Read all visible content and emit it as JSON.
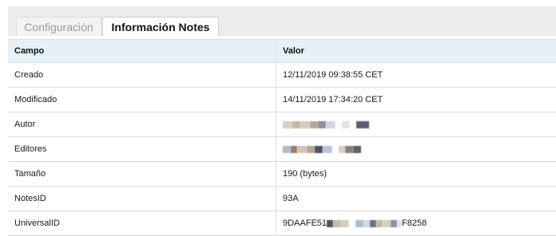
{
  "tabs": [
    {
      "label": "Configuración",
      "active": false
    },
    {
      "label": "Información Notes",
      "active": true
    }
  ],
  "table": {
    "headers": {
      "field": "Campo",
      "value": "Valor"
    },
    "rows": [
      {
        "field": "Creado",
        "value": "12/11/2019 09:38:55 CET"
      },
      {
        "field": "Modificado",
        "value": "14/11/2019 17:34:20 CET"
      },
      {
        "field": "Autor",
        "value": "",
        "redacted": true
      },
      {
        "field": "Editores",
        "value": "",
        "redacted": true
      },
      {
        "field": "Tamaño",
        "value": "190 (bytes)"
      },
      {
        "field": "NotesID",
        "value": "93A"
      },
      {
        "field": "UniversalID",
        "value_prefix": "9DAAFE51",
        "value_suffix": "F8258",
        "partially_redacted": true
      }
    ]
  },
  "colors": {
    "header_background": "#e4f1f9",
    "tabbar_background": "#ececec",
    "row_border": "#d7dde3",
    "redaction_palette": [
      "#d9cfc4",
      "#c7b7a3",
      "#8c8fa6",
      "#a9bccf",
      "#cfd8df",
      "#4e5368",
      "#e8e2d7"
    ]
  }
}
